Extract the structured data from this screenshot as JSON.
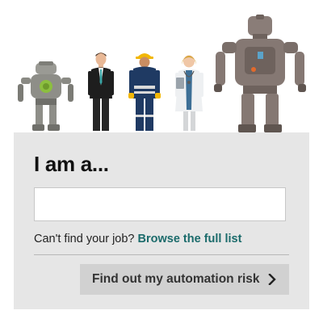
{
  "heading": "I am a...",
  "job_input": {
    "value": "",
    "placeholder": ""
  },
  "help": {
    "prefix": "Can't find your job?",
    "link_label": "Browse the full list"
  },
  "submit": {
    "label": "Find out my automation risk",
    "icon": "chevron-right-icon"
  },
  "figures": [
    {
      "name": "small-robot-figure"
    },
    {
      "name": "businessman-figure"
    },
    {
      "name": "construction-worker-figure"
    },
    {
      "name": "doctor-figure"
    },
    {
      "name": "large-robot-figure"
    }
  ],
  "colors": {
    "panel_bg": "#e6e6e6",
    "link": "#1b6b6b",
    "button_bg": "#d1d1d1",
    "worker_blue": "#1f3a63",
    "hard_hat": "#f2b705",
    "doctor_coat": "#eef0f2"
  }
}
